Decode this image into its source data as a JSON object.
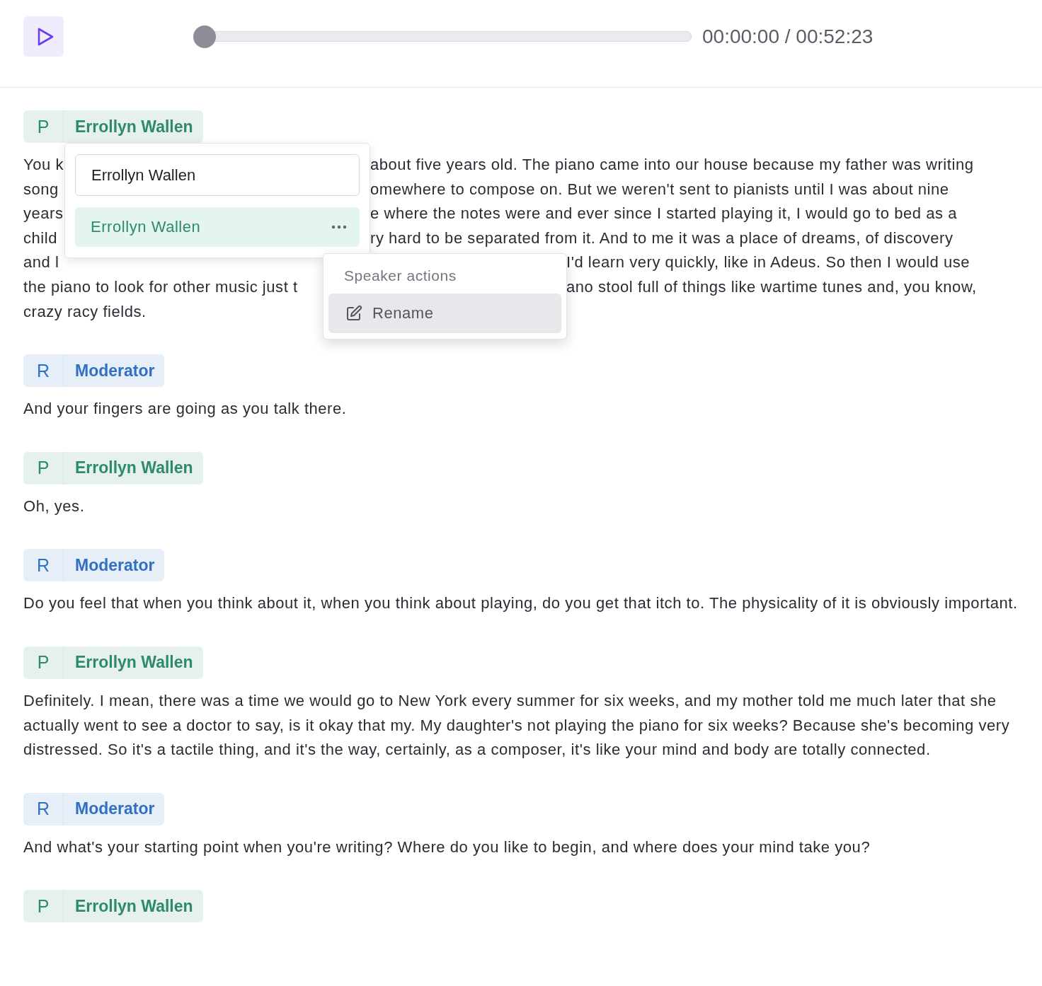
{
  "player": {
    "level": 0,
    "time": "00:00:00 / 00:52:23"
  },
  "segments": [
    {
      "speaker": {
        "initial": "P",
        "name": "Errollyn Wallen",
        "color": "#2e8a6e"
      },
      "lines": [
        {
          "left": "You k",
          "right": "about five years old. The piano came into our house because my father was writing"
        },
        {
          "left": "song",
          "right": "omewhere to compose on. But we weren't sent to pianists until I was about nine"
        },
        {
          "left": "years",
          "right": "e where the notes were and ever since I started playing it, I would go to bed as a"
        },
        {
          "left": "child",
          "right": "ry hard to be separated from it. And to me it was a place of dreams, of discovery"
        },
        {
          "left": "and l",
          "right": "I'd learn very quickly, like in Adeus. So then I would use"
        },
        {
          "left": "the piano to look for other music just t",
          "right": "ano stool full of things like wartime tunes and, you know,"
        },
        {
          "left": "crazy racy fields."
        }
      ]
    },
    {
      "speaker": {
        "initial": "R",
        "name": "Moderator",
        "color": "#2f6fc4"
      },
      "text": "And your fingers are going as you talk there."
    },
    {
      "speaker": {
        "initial": "P",
        "name": "Errollyn Wallen",
        "color": "#2e8a6e"
      },
      "text": "Oh, yes."
    },
    {
      "speaker": {
        "initial": "R",
        "name": "Moderator",
        "color": "#2f6fc4"
      },
      "text": "Do you feel that when you think about it, when you think about playing, do you get that itch to. The physicality of it is obviously important."
    },
    {
      "speaker": {
        "initial": "P",
        "name": "Errollyn Wallen",
        "color": "#2e8a6e"
      },
      "text": "Definitely. I mean, there was a time we would go to New York every summer for six weeks, and my mother told me much later that she actually went to see a doctor to say, is it okay that my. My daughter's not playing the piano for six weeks? Because she's becoming very distressed. So it's a tactile thing, and it's the way, certainly, as a composer, it's like your mind and body are totally connected."
    },
    {
      "speaker": {
        "initial": "R",
        "name": "Moderator",
        "color": "#2f6fc4"
      },
      "text": "And what's your starting point when you're writing? Where do you like to begin, and where does your mind take you?"
    },
    {
      "speaker": {
        "initial": "P",
        "name": "Errollyn Wallen",
        "color": "#2e8a6e"
      }
    }
  ],
  "speaker_menu": {
    "value": "Errollyn Wallen",
    "options": [
      {
        "label": "Errollyn Wallen",
        "selected": true
      }
    ]
  },
  "actions_menu": {
    "title": "Speaker actions",
    "items": [
      {
        "label": "Rename",
        "selected": true
      }
    ]
  }
}
